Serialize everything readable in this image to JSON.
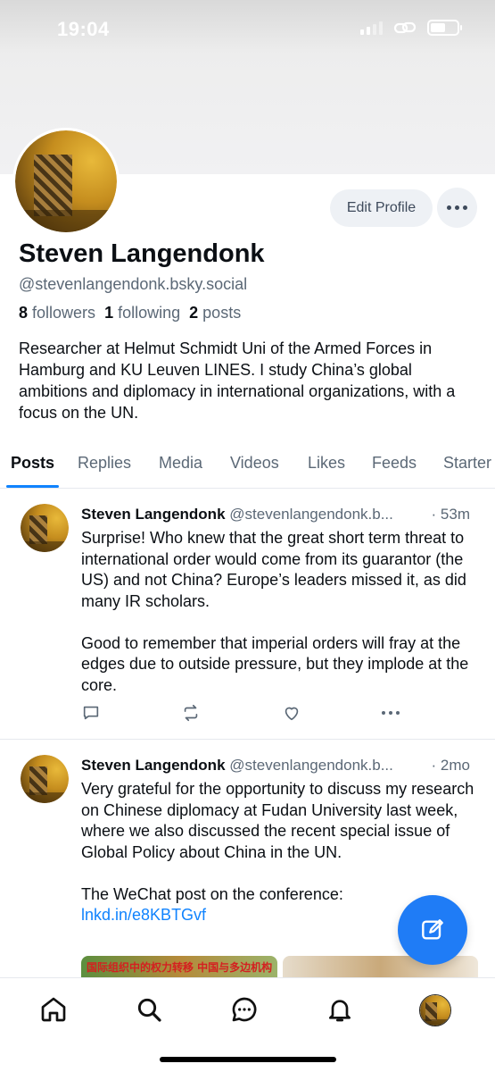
{
  "status_bar": {
    "time": "19:04"
  },
  "profile": {
    "name": "Steven Langendonk",
    "handle": "@stevenlangendonk.bsky.social",
    "followers_count": "8",
    "followers_label": "followers",
    "following_count": "1",
    "following_label": "following",
    "posts_count": "2",
    "posts_label": "posts",
    "bio": "Researcher at Helmut Schmidt Uni of the Armed Forces in Hamburg and KU Leuven LINES. I study China’s global ambitions and diplomacy in international organizations, with a focus on the UN.",
    "edit_label": "Edit Profile"
  },
  "tabs": [
    {
      "label": "Posts"
    },
    {
      "label": "Replies"
    },
    {
      "label": "Media"
    },
    {
      "label": "Videos"
    },
    {
      "label": "Likes"
    },
    {
      "label": "Feeds"
    },
    {
      "label": "Starter"
    }
  ],
  "posts": [
    {
      "author": "Steven Langendonk",
      "handle": "@stevenlangendonk.b...",
      "time": "· 53m",
      "text": "Surprise! Who knew that the great short term threat to international order would come from its guarantor (the US) and not China? Europe’s leaders missed it, as did many IR scholars.\n\nGood to remember that imperial orders will fray at the edges due to outside pressure, but they implode at the core."
    },
    {
      "author": "Steven Langendonk",
      "handle": "@stevenlangendonk.b...",
      "time": "· 2mo",
      "text": "Very grateful for the opportunity to discuss my research on Chinese diplomacy at Fudan University last week, where we also discussed the recent special issue of Global Policy about China in the UN.\n\nThe WeChat post on the conference:",
      "link": "lnkd.in/e8KBTGvf",
      "media_caption": "国际组织中的权力转移 中国与多边机构"
    }
  ],
  "icons": {
    "signal": "signal-icon",
    "link": "link-icon",
    "battery": "battery-icon",
    "reply": "reply-icon",
    "repost": "repost-icon",
    "like": "heart-icon",
    "more": "more-icon",
    "compose": "compose-icon",
    "home": "home-icon",
    "search": "search-icon",
    "chat": "chat-icon",
    "notifications": "bell-icon"
  },
  "colors": {
    "accent": "#1083fe",
    "fab": "#1f7cf6",
    "muted": "#5b6876"
  }
}
